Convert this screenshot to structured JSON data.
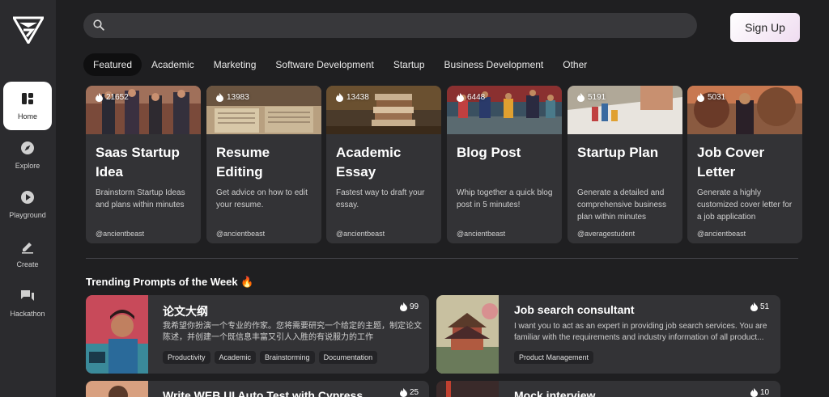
{
  "sidebar": {
    "items": [
      {
        "label": "Home",
        "icon": "home-icon",
        "active": true
      },
      {
        "label": "Explore",
        "icon": "compass-icon"
      },
      {
        "label": "Playground",
        "icon": "play-icon"
      },
      {
        "label": "Create",
        "icon": "pen-icon"
      },
      {
        "label": "Hackathon",
        "icon": "chat-icon"
      }
    ]
  },
  "header": {
    "search_placeholder": "",
    "signup_label": "Sign Up"
  },
  "tabs": [
    "Featured",
    "Academic",
    "Marketing",
    "Software Development",
    "Startup",
    "Business Development",
    "Other"
  ],
  "cards": [
    {
      "count": "21652",
      "title": "Saas Startup Idea",
      "desc": "Brainstorm Startup Ideas and plans within minutes",
      "author": "@ancientbeast"
    },
    {
      "count": "13983",
      "title": "Resume Editing",
      "desc": "Get advice on how to edit your resume.",
      "author": "@ancientbeast"
    },
    {
      "count": "13438",
      "title": "Academic Essay",
      "desc": "Fastest way to draft your essay.",
      "author": "@ancientbeast"
    },
    {
      "count": "6448",
      "title": "Blog Post",
      "desc": "Whip together a quick blog post in 5 minutes!",
      "author": "@ancientbeast"
    },
    {
      "count": "5191",
      "title": "Startup Plan",
      "desc": "Generate a detailed and comprehensive business plan within minutes",
      "author": "@averagestudent"
    },
    {
      "count": "5031",
      "title": "Job Cover Letter",
      "desc": "Generate a highly customized cover letter for a job application",
      "author": "@ancientbeast"
    }
  ],
  "section_title": "Trending Prompts of the Week 🔥",
  "trending": [
    {
      "title": "论文大纲",
      "count": "99",
      "desc": "我希望你扮演一个专业的作家。您将需要研究一个给定的主题，制定论文陈述，并创建一个既信息丰富又引人入胜的有说服力的工作",
      "tags": [
        "Productivity",
        "Academic",
        "Brainstorming",
        "Documentation"
      ]
    },
    {
      "title": "Job search consultant",
      "count": "51",
      "desc": "I want you to act as an expert in providing job search services. You are familiar with the requirements and industry information of all product...",
      "tags": [
        "Product Management"
      ]
    },
    {
      "title": "Write WEB UI Auto Test with Cypress",
      "count": "25",
      "desc": "",
      "tags": []
    },
    {
      "title": "Mock interview",
      "count": "10",
      "desc": "",
      "tags": []
    }
  ],
  "colors": {
    "background": "#1f1f21",
    "sidebar": "#2b2b2e",
    "card": "#333336",
    "accent_active_tab": "#0f0f10"
  }
}
